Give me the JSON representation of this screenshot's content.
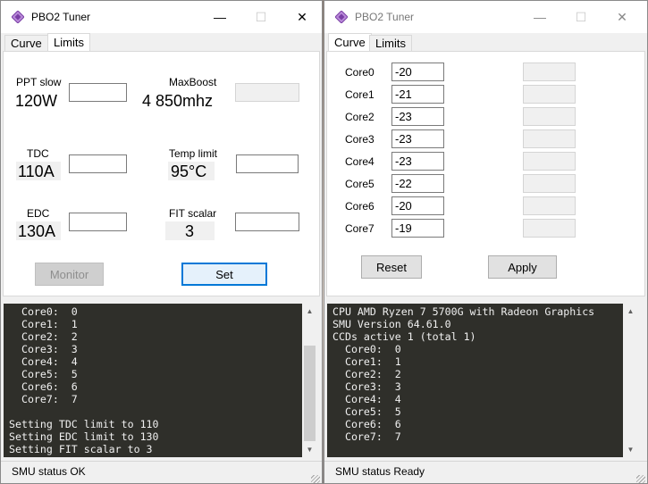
{
  "left_window": {
    "title": "PBO2 Tuner",
    "tabs": [
      {
        "label": "Curve"
      },
      {
        "label": "Limits"
      }
    ],
    "limits": {
      "ppt_label": "PPT slow",
      "ppt_value": "120W",
      "maxboost_label": "MaxBoost",
      "maxboost_value": "4 850mhz",
      "tdc_label": "TDC",
      "tdc_value": "110A",
      "temp_label": "Temp limit",
      "temp_value": "95°C",
      "edc_label": "EDC",
      "edc_value": "130A",
      "fit_label": "FIT scalar",
      "fit_value": "3"
    },
    "monitor_label": "Monitor",
    "set_label": "Set",
    "console": "  Core0:  0\n  Core1:  1\n  Core2:  2\n  Core3:  3\n  Core4:  4\n  Core5:  5\n  Core6:  6\n  Core7:  7\n\nSetting TDC limit to 110\nSetting EDC limit to 130\nSetting FIT scalar to 3",
    "status": "SMU status OK"
  },
  "right_window": {
    "title": "PBO2 Tuner",
    "tabs": [
      {
        "label": "Curve"
      },
      {
        "label": "Limits"
      }
    ],
    "cores": [
      {
        "label": "Core0",
        "value": "-20"
      },
      {
        "label": "Core1",
        "value": "-21"
      },
      {
        "label": "Core2",
        "value": "-23"
      },
      {
        "label": "Core3",
        "value": "-23"
      },
      {
        "label": "Core4",
        "value": "-23"
      },
      {
        "label": "Core5",
        "value": "-22"
      },
      {
        "label": "Core6",
        "value": "-20"
      },
      {
        "label": "Core7",
        "value": "-19"
      }
    ],
    "reset_label": "Reset",
    "apply_label": "Apply",
    "console": "CPU AMD Ryzen 7 5700G with Radeon Graphics\nSMU Version 64.61.0\nCCDs active 1 (total 1)\n  Core0:  0\n  Core1:  1\n  Core2:  2\n  Core3:  3\n  Core4:  4\n  Core5:  5\n  Core6:  6\n  Core7:  7",
    "status": "SMU status Ready"
  },
  "colors": {
    "accent": "#0078d7",
    "console_bg": "#2f2f2a",
    "icon": "#8a4fb8"
  },
  "icons": {
    "app": "diamond-logo-icon",
    "minimize": "minimize-icon",
    "maximize": "maximize-icon",
    "close": "close-icon"
  }
}
